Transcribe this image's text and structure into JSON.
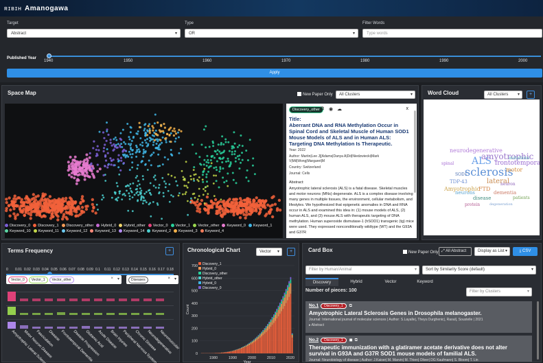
{
  "app": {
    "logo_mark": "ʀɪʙɪʜ",
    "name": "Amanogawa"
  },
  "filter": {
    "target_label": "Target",
    "target_value": "Abstract",
    "type_label": "Type",
    "type_value": "OR",
    "words_label": "Filter Words",
    "words_placeholder": "Type words",
    "year_label": "Published Year",
    "year_ticks": [
      "1940",
      "1950",
      "1960",
      "1970",
      "1980",
      "1990",
      "2000"
    ],
    "apply_label": "Apply"
  },
  "space_map": {
    "title": "Space Map",
    "new_paper_only": "New Paper Only",
    "cluster_select": "All Clusters",
    "legend": [
      {
        "label": "Discovery_0",
        "color": "#7b5fd6"
      },
      {
        "label": "Discovery_1",
        "color": "#f2613b"
      },
      {
        "label": "Discovery_other",
        "color": "#f39a57"
      },
      {
        "label": "Hybrid_0",
        "color": "#c46ad2"
      },
      {
        "label": "Hybrid_other",
        "color": "#f0d56b"
      },
      {
        "label": "Vector_0",
        "color": "#e9427c"
      },
      {
        "label": "Vector_1",
        "color": "#29d19c"
      },
      {
        "label": "Vector_other",
        "color": "#9ad84f"
      },
      {
        "label": "Keyword_0",
        "color": "#e87bd0"
      },
      {
        "label": "Keyword_1",
        "color": "#3fb6e6"
      },
      {
        "label": "Keyword_10",
        "color": "#5bd6a4"
      },
      {
        "label": "Keyword_11",
        "color": "#c6d949"
      },
      {
        "label": "Keyword_12",
        "color": "#6cc9f0"
      },
      {
        "label": "Keyword_13",
        "color": "#ff8a7a"
      },
      {
        "label": "Keyword_14",
        "color": "#b48cf3"
      },
      {
        "label": "Keyword_2",
        "color": "#4bd1d1"
      },
      {
        "label": "Keyword_3",
        "color": "#f5b24a"
      },
      {
        "label": "Keyword_4",
        "color": "#f27c5b"
      }
    ]
  },
  "detail": {
    "tag": "Discovery_other",
    "close": "x",
    "title_label": "Title:",
    "title": "Aberrant DNA and RNA Methylation Occur in Spinal Cord and Skeletal Muscle of Human SOD1 Mouse Models of ALS and in Human ALS: Targeting DNA Methylation Is Therapeutic.",
    "year": "Year: 2022",
    "author": "Author: Martin|Lee J|[Adams|Danya A|Dd|Niedzwiecki|Mark V|Mil|Wong|Margaret|M",
    "country": "Country: Switzerland",
    "journal": "Journal: Cells",
    "abstract_label": "Abstract:",
    "abstract": "Amyotrophic lateral sclerosis (ALS) is a fatal disease. Skeletal muscles and motor neurons (MNs) degenerate. ALS is a complex disease involving many genes in multiple tissues, the environment, cellular metabolism, and lifestyles. We hypothesized that epigenetic anomalies in DNA and RNA occur in ALS and examined this idea in: (1) mouse models of ALS, (2) human ALS, and (3) mouse ALS with therapeutic targeting of DNA methylation. Human superoxide dismutase-1 (hSOD1) transgenic (tg) mice were used. They expressed nonconditionally wildtype (WT) and the G93A and G37R"
  },
  "word_cloud": {
    "title": "Word Cloud",
    "cluster_select": "All Clusters",
    "words": [
      {
        "text": "sclerosis",
        "color": "#5b8fd6"
      },
      {
        "text": "ALS",
        "color": "#6aa0e8"
      },
      {
        "text": "amyotrophic",
        "color": "#9a77cc"
      },
      {
        "text": "neurodegenerative",
        "color": "#b07ad8"
      },
      {
        "text": "lateral",
        "color": "#c98c52"
      },
      {
        "text": "frontotemporal",
        "color": "#9a6bd1"
      },
      {
        "text": "TDP-43",
        "color": "#6d8fd3"
      },
      {
        "text": "motor",
        "color": "#d48b3a"
      },
      {
        "text": "neurons",
        "color": "#5aa3d0"
      },
      {
        "text": "disease",
        "color": "#3e8c7d"
      },
      {
        "text": "dementia",
        "color": "#cc7a66"
      },
      {
        "text": "Amyotrophic",
        "color": "#caa24b"
      },
      {
        "text": "neuron",
        "color": "#8a5fb8"
      },
      {
        "text": "patients",
        "color": "#6f9f4f"
      },
      {
        "text": "protein",
        "color": "#b0548e"
      },
      {
        "text": "SOD1",
        "color": "#4a6fb1"
      },
      {
        "text": "degeneration",
        "color": "#7a9fd0"
      },
      {
        "text": "spinal",
        "color": "#a56ad3"
      },
      {
        "text": "mutations",
        "color": "#52a9b5"
      },
      {
        "text": "FTD",
        "color": "#d3884c"
      }
    ]
  },
  "terms": {
    "title": "Terms Frequency",
    "ticks": [
      "0",
      "0.01",
      "0.02",
      "0.03",
      "0.04",
      "0.05",
      "0.06",
      "0.07",
      "0.08",
      "0.09",
      "0.1",
      "0.11",
      "0.12",
      "0.13",
      "0.14",
      "0.15",
      "0.16",
      "0.17",
      "0.18"
    ],
    "chips": [
      "Vector_0",
      "Vector_1",
      "Vector_other"
    ],
    "chip_colors": [
      "#e9427c",
      "#9ad84f",
      "#b48cf3"
    ],
    "chip2": "Diseases",
    "terms_list": [
      "Amyotrophic Lateral Sclerosis",
      "Motor Neuron Disease",
      "Fasciculation",
      "Disease",
      "Frontotemporal Dementia",
      "Disease Progression",
      "Glutamic Acid",
      "Acute Disease",
      "Brain Injuries",
      "Peripheral Nervous System",
      "Chronic Disease",
      "Neurodegenerative",
      "Neuromuscular"
    ]
  },
  "chrono": {
    "title": "Chronological Chart",
    "select": "Vector",
    "legend": [
      {
        "label": "Discovery_1",
        "color": "#f2613b"
      },
      {
        "label": "Hybrid_0",
        "color": "#f39a57"
      },
      {
        "label": "Discovery_other",
        "color": "#29d19c"
      },
      {
        "label": "Hybrid_other",
        "color": "#4bd1d1"
      },
      {
        "label": "Hybrid_0",
        "color": "#3fb6e6"
      },
      {
        "label": "Discovery_0",
        "color": "#7b5fd6"
      }
    ],
    "y_ticks": [
      "700",
      "600",
      "500",
      "400",
      "300",
      "200",
      "100",
      "0"
    ],
    "x_ticks": [
      "1980",
      "1990",
      "2000",
      "2010",
      "2020"
    ],
    "ylabel": "Count",
    "xlabel": "Year"
  },
  "cardbox": {
    "title": "Card Box",
    "new_paper_only": "New Paper Only",
    "all_abstract": "All Abstract",
    "display_select": "Display as List",
    "csv": "CSV",
    "human_filter": "Filter by Human/Animal",
    "sort_select": "Sort by Similarity Score (default)",
    "tabs": [
      "Discovery",
      "Hybrid",
      "Vector",
      "Keyword"
    ],
    "count": "Number of pieces: 100",
    "cluster_filter": "Filter by Clusters",
    "cards": [
      {
        "no": "No.1",
        "badge": "Discovery_1",
        "title": "Amyotrophic Lateral Sclerosis Genes in Drosophila melanogaster.",
        "meta": "Journal: International journal of molecular sciences | Author: S.Layalle|, Theys.Ourghenic|, Raoul|, Soustelle | 2021",
        "abstract": "Abstract"
      },
      {
        "no": "No.2",
        "badge": "Discovery_1",
        "title": "Therapeutic immunization with a glatiramer acetate derivative does not alter survival in G93A and G37R SOD1 mouse models of familial ALS.",
        "meta": "Journal: Neurobiology of disease | Author: J.Kaiser| M. Marvin| M. Thien| Oliver| DG Kaufmann| S. Bloom| T. Lin",
        "abstract": "Abstract"
      }
    ]
  }
}
